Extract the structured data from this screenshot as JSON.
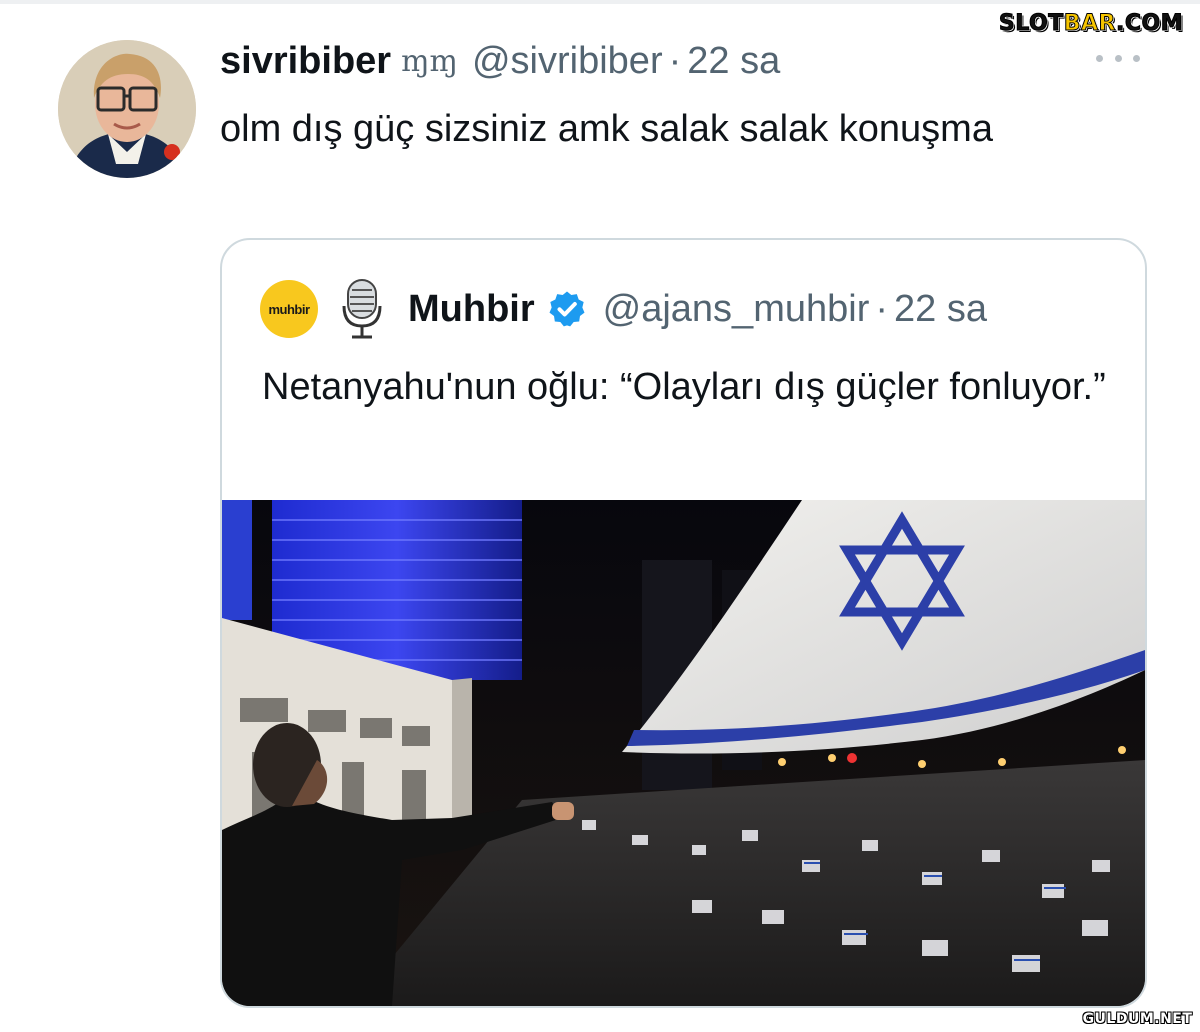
{
  "watermarks": {
    "top_a": "SLOT",
    "top_b": "BAR",
    "top_c": ".COM",
    "bottom": "GULDUM.NET"
  },
  "tweet": {
    "display_name": "sivribiber",
    "name_symbol": "ɱɱ",
    "handle": "@sivribiber",
    "separator": "·",
    "time": "22 sa",
    "text": "olm dış güç sizsiniz amk salak salak konuşma",
    "more_icon": "ellipsis-icon"
  },
  "quote": {
    "logo_text": "muhbir",
    "display_name": "Muhbir",
    "verified_icon": "verified-badge-icon",
    "handle": "@ajans_muhbir",
    "separator": "·",
    "time": "22 sa",
    "text": "Netanyahu'nun oğlu: “Olayları dış güçler fonluyor.”",
    "media": "protest-photo"
  },
  "colors": {
    "text": "#0f1419",
    "secondary": "#536471",
    "border": "#cfd9de",
    "verified": "#1d9bf0",
    "logo_bg": "#f8c81e",
    "watermark_accent": "#f7c600"
  }
}
